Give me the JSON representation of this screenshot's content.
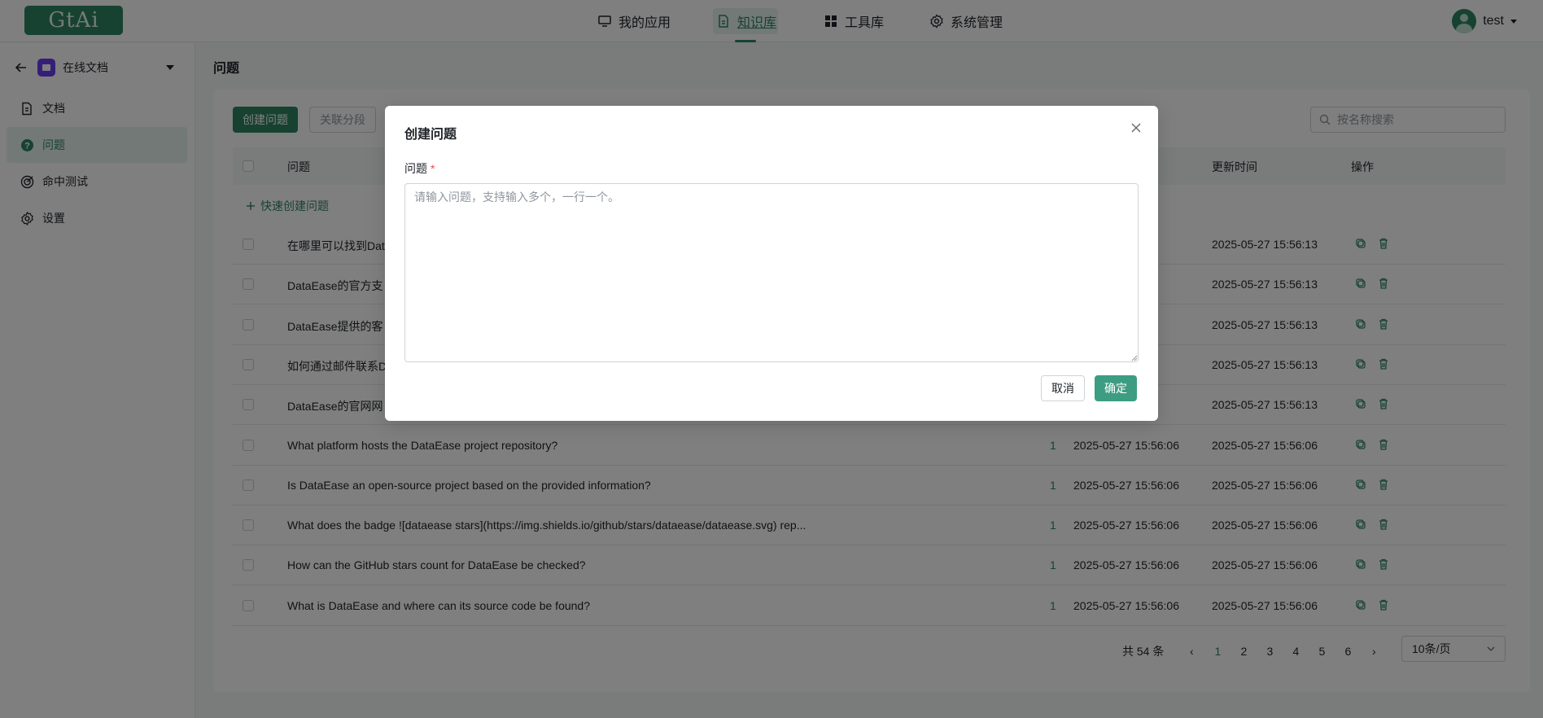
{
  "app": {
    "logo_text": "GtAi"
  },
  "topnav": {
    "items": [
      {
        "label": "我的应用",
        "icon": "monitor-icon"
      },
      {
        "label": "知识库",
        "icon": "document-icon",
        "active": true
      },
      {
        "label": "工具库",
        "icon": "grid-icon"
      },
      {
        "label": "系统管理",
        "icon": "gear-icon"
      }
    ],
    "user": "test"
  },
  "sidebar": {
    "kb_name": "在线文档",
    "items": [
      {
        "label": "文档",
        "icon": "document-icon"
      },
      {
        "label": "问题",
        "icon": "question-icon",
        "active": true
      },
      {
        "label": "命中测试",
        "icon": "target-icon"
      },
      {
        "label": "设置",
        "icon": "gear-icon"
      }
    ]
  },
  "main": {
    "title": "问题",
    "toolbar": {
      "create_label": "创建问题",
      "link_label": "关联分段"
    },
    "search": {
      "placeholder": "按名称搜索"
    },
    "table": {
      "headers": {
        "question": "问题",
        "updated": "更新时间",
        "ops": "操作"
      },
      "quick_create": "快速创建问题",
      "rows": [
        {
          "q": "在哪里可以找到Dat",
          "hit": "",
          "t1": "56:13",
          "t2": "2025-05-27 15:56:13"
        },
        {
          "q": "DataEase的官方支",
          "hit": "",
          "t1": "56:13",
          "t2": "2025-05-27 15:56:13"
        },
        {
          "q": "DataEase提供的客",
          "hit": "",
          "t1": "56:13",
          "t2": "2025-05-27 15:56:13"
        },
        {
          "q": "如何通过邮件联系D",
          "hit": "",
          "t1": "56:13",
          "t2": "2025-05-27 15:56:13"
        },
        {
          "q": "DataEase的官网网",
          "hit": "",
          "t1": "56:13",
          "t2": "2025-05-27 15:56:13"
        },
        {
          "q": "What platform hosts the DataEase project repository?",
          "hit": "1",
          "t1": "2025-05-27 15:56:06",
          "t2": "2025-05-27 15:56:06"
        },
        {
          "q": "Is DataEase an open-source project based on the provided information?",
          "hit": "1",
          "t1": "2025-05-27 15:56:06",
          "t2": "2025-05-27 15:56:06"
        },
        {
          "q": "What does the badge ![dataease stars](https://img.shields.io/github/stars/dataease/dataease.svg) rep...",
          "hit": "1",
          "t1": "2025-05-27 15:56:06",
          "t2": "2025-05-27 15:56:06"
        },
        {
          "q": "How can the GitHub stars count for DataEase be checked?",
          "hit": "1",
          "t1": "2025-05-27 15:56:06",
          "t2": "2025-05-27 15:56:06"
        },
        {
          "q": "What is DataEase and where can its source code be found?",
          "hit": "1",
          "t1": "2025-05-27 15:56:06",
          "t2": "2025-05-27 15:56:06"
        }
      ]
    },
    "pagination": {
      "total": "共 54 条",
      "pages": [
        "1",
        "2",
        "3",
        "4",
        "5",
        "6"
      ],
      "current": "1",
      "page_size": "10条/页"
    }
  },
  "dialog": {
    "title": "创建问题",
    "field_label": "问题",
    "required_mark": "*",
    "placeholder": "请输入问题，支持输入多个，一行一个。",
    "value": "",
    "cancel_label": "取消",
    "ok_label": "确定"
  },
  "colors": {
    "accent": "#2e8563",
    "required": "#f54a45",
    "ok_button": "#3d9d82"
  }
}
